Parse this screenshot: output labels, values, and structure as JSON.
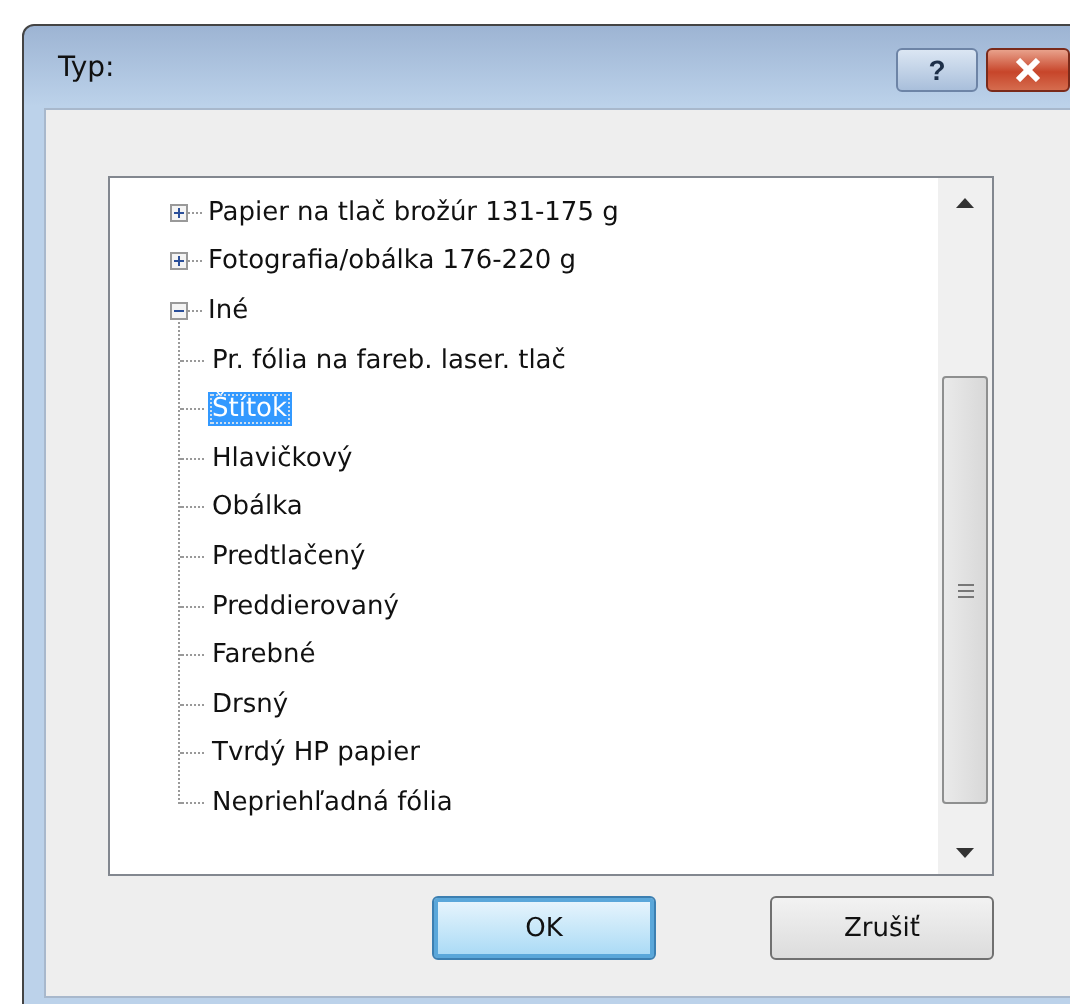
{
  "window": {
    "title": "Typ:",
    "help_button": "?"
  },
  "tree": [
    {
      "label": "Papier na tlač brožúr 131-175 g",
      "expanded": false,
      "selected": false
    },
    {
      "label": "Fotografia/obálka 176-220 g",
      "expanded": false,
      "selected": false
    },
    {
      "label": "Iné",
      "expanded": true,
      "selected": false,
      "children": [
        {
          "label": "Pr. fólia na fareb. laser. tlač",
          "selected": false
        },
        {
          "label": "Štítok",
          "selected": true
        },
        {
          "label": "Hlavičkový",
          "selected": false
        },
        {
          "label": "Obálka",
          "selected": false
        },
        {
          "label": "Predtlačený",
          "selected": false
        },
        {
          "label": "Preddierovaný",
          "selected": false
        },
        {
          "label": "Farebné",
          "selected": false
        },
        {
          "label": "Drsný",
          "selected": false
        },
        {
          "label": "Tvrdý HP papier",
          "selected": false
        },
        {
          "label": "Nepriehľadná fólia",
          "selected": false
        }
      ]
    }
  ],
  "buttons": [
    {
      "label": "OK",
      "default": true
    },
    {
      "label": "Zrušiť",
      "default": false
    }
  ]
}
